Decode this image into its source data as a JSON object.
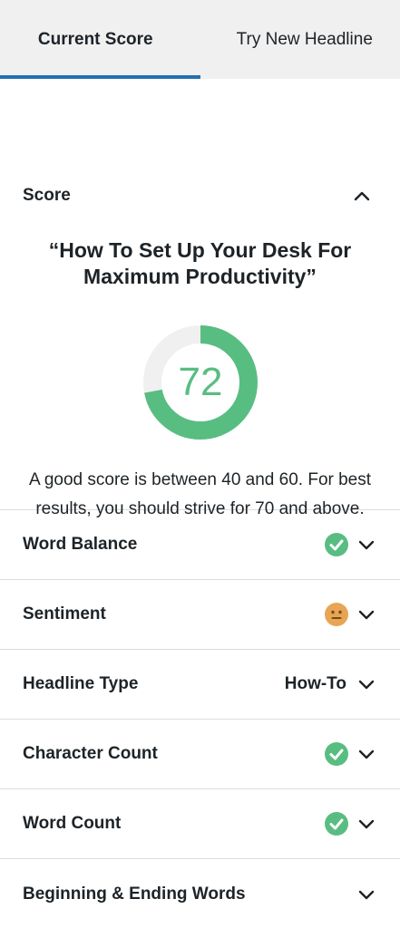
{
  "tabs": {
    "current_score": "Current Score",
    "try_new_headline": "Try New Headline"
  },
  "score_section": {
    "title": "Score",
    "headline": "“How To Set Up Your Desk For Maximum Productivity”",
    "score": "72",
    "score_fraction": 0.72,
    "note": "A good score is between 40 and 60. For best results, you should strive for 70 and above.",
    "colors": {
      "good": "#58bd81",
      "track": "#f0f0f1",
      "neutral": "#e8a555",
      "accent": "#2271b1"
    }
  },
  "rows": [
    {
      "label": "Word Balance",
      "status": "check-icon"
    },
    {
      "label": "Sentiment",
      "status": "neutral-face-icon"
    },
    {
      "label": "Headline Type",
      "value": "How-To"
    },
    {
      "label": "Character Count",
      "status": "check-icon"
    },
    {
      "label": "Word Count",
      "status": "check-icon"
    },
    {
      "label": "Beginning & Ending Words"
    }
  ]
}
